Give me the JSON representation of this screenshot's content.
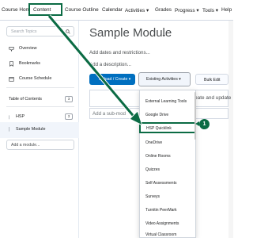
{
  "nav": {
    "items": [
      "Course Home",
      "Content",
      "Course Outline",
      "Calendar",
      "Activities ▾",
      "Grades",
      "Progress ▾",
      "Tools ▾",
      "Help"
    ],
    "highlighted": "Content"
  },
  "sidebar": {
    "search_placeholder": "Search Topics",
    "overview": "Overview",
    "bookmarks": "Bookmarks",
    "course_schedule": "Course Schedule",
    "toc": "Table of Contents",
    "toc_count": "3",
    "hsp": "HSP",
    "hsp_count": "3",
    "sample_module": "Sample Module",
    "add_module": "Add a module..."
  },
  "main": {
    "title": "Sample Module",
    "add_dates": "Add dates and restrictions...",
    "add_description": "Add a description...",
    "upload_button": "Upload / Create ▾",
    "existing_button": "Existing Activities ▾",
    "bulk_button": "Bulk Edit",
    "create_text": "reate and update",
    "add_submodule": "Add a sub-mod"
  },
  "menu": {
    "items": [
      "External Learning Tools",
      "Google Drive",
      "HSP Quicklink",
      "OneDrive",
      "Online Rooms",
      "Quizzes",
      "Self Assessments",
      "Surveys",
      "Turnitin PeerMark",
      "Video Assignments",
      "Virtual Classroom"
    ],
    "selected": "HSP Quicklink"
  },
  "callout": {
    "number": "1"
  },
  "colors": {
    "accent": "#0b6b44",
    "primary": "#006fbf"
  }
}
